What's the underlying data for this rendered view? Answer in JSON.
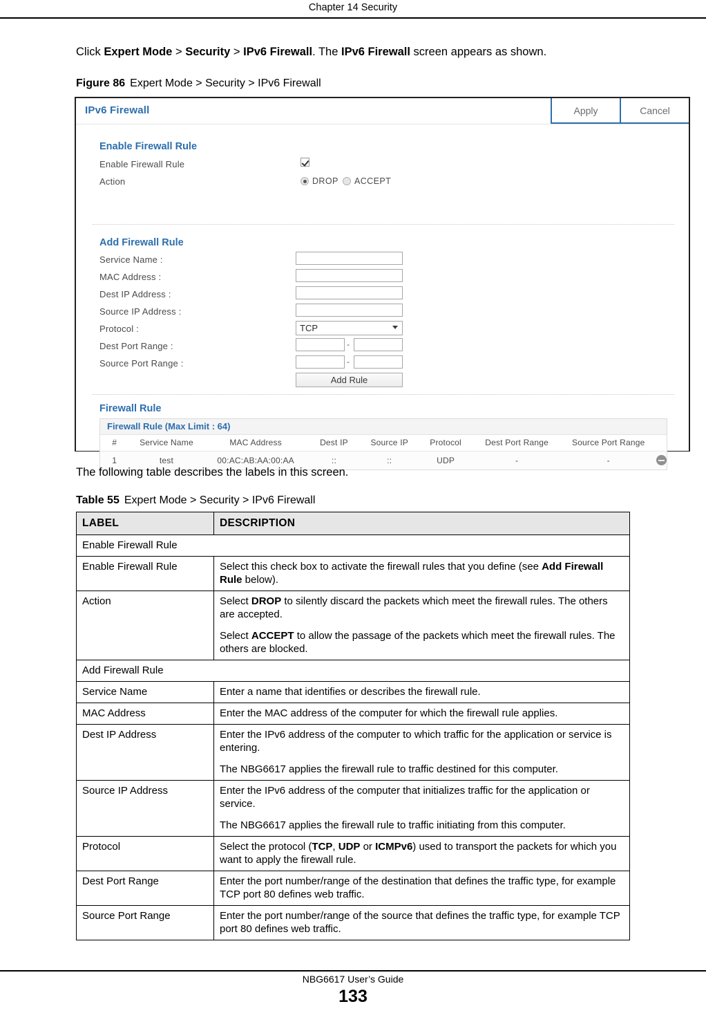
{
  "page": {
    "running_header": "Chapter 14 Security",
    "footer_guide": "NBG6617 User’s Guide",
    "page_number": "133"
  },
  "intro": {
    "prefix": "Click ",
    "path_1": "Expert Mode",
    "sep_1": " > ",
    "path_2": "Security",
    "sep_2": " > ",
    "path_3": "IPv6 Firewall",
    "middle": ". The ",
    "path_4": "IPv6 Firewall",
    "suffix": " screen appears as shown."
  },
  "figure": {
    "label": "Figure 86",
    "caption": "Expert Mode > Security > IPv6 Firewall"
  },
  "screenshot": {
    "title": "IPv6 Firewall",
    "apply_label": "Apply",
    "cancel_label": "Cancel",
    "accent_color": "#2c6ead",
    "section_enable": {
      "heading": "Enable Firewall Rule",
      "checkbox_label": "Enable Firewall Rule",
      "checkbox_checked": true,
      "action_label": "Action",
      "radio_drop": "DROP",
      "radio_accept": "ACCEPT",
      "action_selected": "DROP"
    },
    "section_add": {
      "heading": "Add Firewall Rule",
      "fields": [
        {
          "label": "Service Name :",
          "value": ""
        },
        {
          "label": "MAC Address :",
          "value": ""
        },
        {
          "label": "Dest IP Address :",
          "value": ""
        },
        {
          "label": "Source IP Address :",
          "value": ""
        }
      ],
      "protocol_label": "Protocol :",
      "protocol_value": "TCP",
      "dest_port_label": "Dest Port Range :",
      "dest_port_from": "",
      "dest_port_to": "",
      "source_port_label": "Source Port Range :",
      "source_port_from": "",
      "source_port_to": "",
      "range_separator": "-",
      "add_rule_label": "Add Rule"
    },
    "section_rules": {
      "heading": "Firewall Rule",
      "box_title": "Firewall Rule (Max Limit : 64)",
      "columns": [
        "#",
        "Service Name",
        "MAC Address",
        "Dest IP",
        "Source IP",
        "Protocol",
        "Dest Port Range",
        "Source Port Range",
        ""
      ],
      "rows": [
        {
          "index": "1",
          "service_name": "test",
          "mac_address": "00:AC:AB:AA:00:AA",
          "dest_ip": "::",
          "source_ip": "::",
          "protocol": "UDP",
          "dest_port_range": "-",
          "source_port_range": "-"
        }
      ]
    }
  },
  "following_text": "The following table describes the labels in this screen.",
  "table": {
    "label": "Table 55",
    "caption": "Expert Mode > Security > IPv6 Firewall",
    "headers": {
      "label": "LABEL",
      "description": "DESCRIPTION"
    },
    "rows": [
      {
        "type": "section",
        "label": "Enable Firewall Rule"
      },
      {
        "type": "row",
        "label": "Enable Firewall Rule",
        "paras": [
          [
            {
              "t": "Select this check box to activate the firewall rules that you define (see ",
              "b": false
            },
            {
              "t": "Add Firewall Rule",
              "b": true
            },
            {
              "t": " below).",
              "b": false
            }
          ]
        ]
      },
      {
        "type": "row",
        "label": "Action",
        "paras": [
          [
            {
              "t": "Select ",
              "b": false
            },
            {
              "t": "DROP",
              "b": true
            },
            {
              "t": " to silently discard the packets which meet the firewall rules. The others are accepted.",
              "b": false
            }
          ],
          [
            {
              "t": "Select ",
              "b": false
            },
            {
              "t": "ACCEPT",
              "b": true
            },
            {
              "t": " to allow the passage of the packets which meet the firewall rules. The others are blocked.",
              "b": false
            }
          ]
        ]
      },
      {
        "type": "section",
        "label": "Add Firewall Rule"
      },
      {
        "type": "row",
        "label": "Service Name",
        "paras": [
          [
            {
              "t": "Enter a name that identifies or describes the firewall rule.",
              "b": false
            }
          ]
        ]
      },
      {
        "type": "row",
        "label": "MAC Address",
        "paras": [
          [
            {
              "t": "Enter the MAC address of the computer for which the firewall rule applies.",
              "b": false
            }
          ]
        ]
      },
      {
        "type": "row",
        "label": "Dest IP Address",
        "paras": [
          [
            {
              "t": "Enter the IPv6 address of the computer to which traffic for the application or service is entering.",
              "b": false
            }
          ],
          [
            {
              "t": "The NBG6617 applies the firewall rule to traffic destined for this computer.",
              "b": false
            }
          ]
        ]
      },
      {
        "type": "row",
        "label": "Source IP Address",
        "paras": [
          [
            {
              "t": "Enter the IPv6 address of the computer that initializes traffic for the application or service.",
              "b": false
            }
          ],
          [
            {
              "t": "The NBG6617 applies the firewall rule to traffic initiating from this computer.",
              "b": false
            }
          ]
        ]
      },
      {
        "type": "row",
        "label": "Protocol",
        "paras": [
          [
            {
              "t": "Select the protocol (",
              "b": false
            },
            {
              "t": "TCP",
              "b": true
            },
            {
              "t": ", ",
              "b": false
            },
            {
              "t": "UDP",
              "b": true
            },
            {
              "t": " or ",
              "b": false
            },
            {
              "t": "ICMPv6",
              "b": true
            },
            {
              "t": ") used to transport the packets for which you want to apply the firewall rule.",
              "b": false
            }
          ]
        ]
      },
      {
        "type": "row",
        "label": "Dest Port Range",
        "paras": [
          [
            {
              "t": "Enter the port number/range of the destination that defines the traffic type, for example TCP port 80 defines web traffic.",
              "b": false
            }
          ]
        ]
      },
      {
        "type": "row",
        "label": "Source Port Range",
        "paras": [
          [
            {
              "t": "Enter the port number/range of the source that defines the traffic type, for example TCP port 80 defines web traffic.",
              "b": false
            }
          ]
        ]
      }
    ]
  }
}
